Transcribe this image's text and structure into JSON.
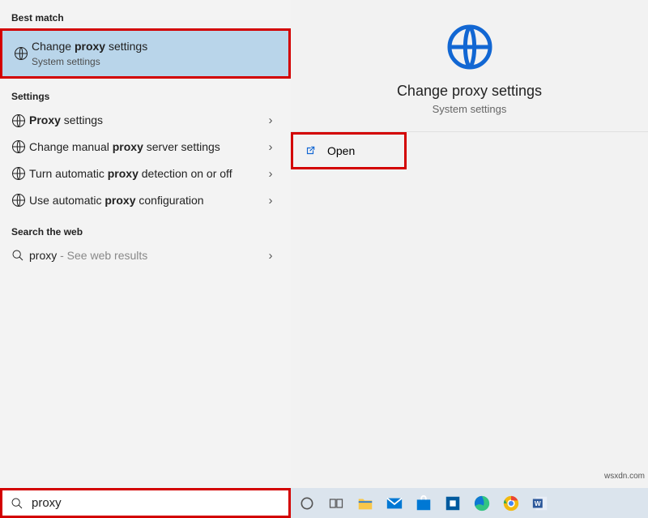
{
  "left": {
    "best_match_header": "Best match",
    "best_match": {
      "title_pre": "Change ",
      "title_bold": "proxy",
      "title_post": " settings",
      "sub": "System settings"
    },
    "settings_header": "Settings",
    "settings_items": [
      {
        "pre": "",
        "bold": "Proxy",
        "post": " settings"
      },
      {
        "pre": "Change manual ",
        "bold": "proxy",
        "post": " server settings"
      },
      {
        "pre": "Turn automatic ",
        "bold": "proxy",
        "post": " detection on or off"
      },
      {
        "pre": "Use automatic ",
        "bold": "proxy",
        "post": " configuration"
      }
    ],
    "web_header": "Search the web",
    "web": {
      "term": "proxy",
      "hint": " - See web results"
    }
  },
  "detail": {
    "title": "Change proxy settings",
    "sub": "System settings"
  },
  "actions": {
    "open": "Open"
  },
  "search": {
    "query": "proxy"
  },
  "watermark": "wsxdn.com"
}
